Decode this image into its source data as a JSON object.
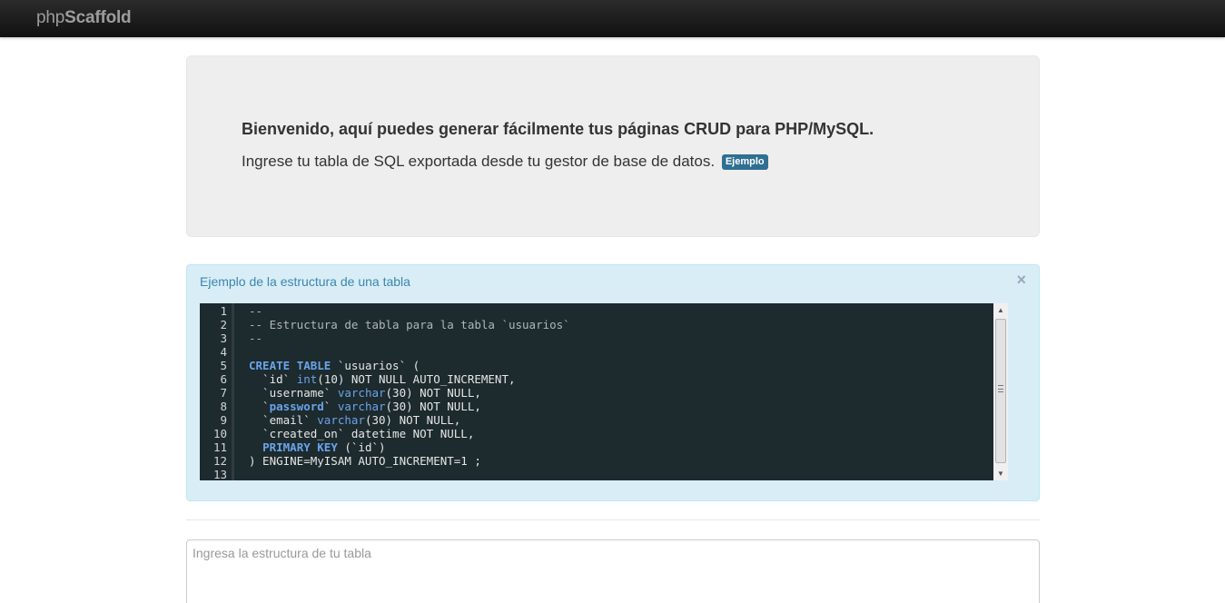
{
  "navbar": {
    "brand_light": "php",
    "brand_bold": "Scaffold"
  },
  "hero": {
    "title": "Bienvenido, aquí puedes generar fácilmente tus páginas CRUD para PHP/MySQL.",
    "subtitle": "Ingrese tu tabla de SQL exportada desde tu gestor de base de datos.",
    "badge": "Ejemplo"
  },
  "example": {
    "title": "Ejemplo de la estructura de una tabla",
    "close": "×",
    "help": "?",
    "lines": [
      {
        "n": "1",
        "text": "--"
      },
      {
        "n": "2",
        "text": "-- Estructura de tabla para la tabla `usuarios`"
      },
      {
        "n": "3",
        "text": "--"
      },
      {
        "n": "4",
        "text": ""
      },
      {
        "n": "5",
        "text": "CREATE TABLE `usuarios` ("
      },
      {
        "n": "6",
        "text": "  `id` int(10) NOT NULL AUTO_INCREMENT,"
      },
      {
        "n": "7",
        "text": "  `username` varchar(30) NOT NULL,"
      },
      {
        "n": "8",
        "text": "  `password` varchar(30) NOT NULL,"
      },
      {
        "n": "9",
        "text": "  `email` varchar(30) NOT NULL,"
      },
      {
        "n": "10",
        "text": "  `created_on` datetime NOT NULL,"
      },
      {
        "n": "11",
        "text": "  PRIMARY KEY (`id`)"
      },
      {
        "n": "12",
        "text": ") ENGINE=MyISAM AUTO_INCREMENT=1 ;"
      },
      {
        "n": "13",
        "text": ""
      }
    ]
  },
  "input": {
    "placeholder": "Ingresa la estructura de tu tabla",
    "value": ""
  },
  "colors": {
    "navbar": "#1b1b1b",
    "hero_bg": "#eeeeee",
    "alert_bg": "#d9edf7",
    "alert_text": "#3a87ad",
    "editor_bg": "#1d2a2e",
    "badge": "#2f6f91"
  }
}
